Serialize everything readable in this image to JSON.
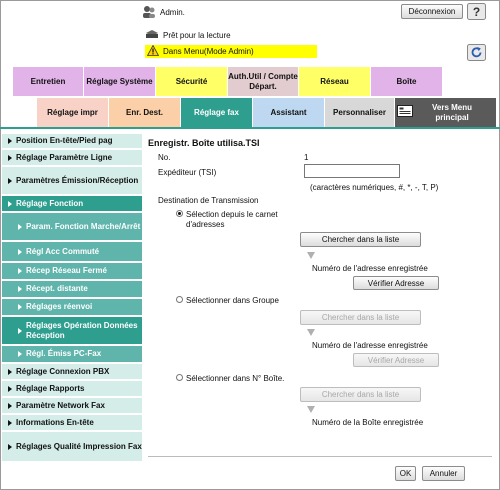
{
  "header": {
    "user": "Admin.",
    "logout_label": "Déconnexion",
    "status_ready": "Prêt pour la lecture",
    "mode_banner": "Dans Menu(Mode Admin)"
  },
  "tabs_top": [
    {
      "label": "Entretien"
    },
    {
      "label": "Réglage Système"
    },
    {
      "label": "Sécurité"
    },
    {
      "label": "Auth.Util / Compte Départ."
    },
    {
      "label": "Réseau"
    },
    {
      "label": "Boîte"
    }
  ],
  "tabs_bottom": [
    {
      "label": "Réglage impr"
    },
    {
      "label": "Enr. Dest."
    },
    {
      "label": "Réglage fax"
    },
    {
      "label": "Assistant"
    },
    {
      "label": "Personnaliser"
    },
    {
      "label": "Vers Menu principal"
    }
  ],
  "sidebar": {
    "items": [
      {
        "label": "Position En-tête/Pied pag"
      },
      {
        "label": "Réglage Paramètre Ligne"
      },
      {
        "label": "Paramètres Émission/Réception"
      },
      {
        "label": "Réglage Fonction"
      },
      {
        "label": "Param. Fonction Marche/Arrêt"
      },
      {
        "label": "Régl Acc Commuté"
      },
      {
        "label": "Récep Réseau Fermé"
      },
      {
        "label": "Récept. distante"
      },
      {
        "label": "Réglages réenvoi"
      },
      {
        "label": "Réglages Opération Données Réception"
      },
      {
        "label": "Régl. Émiss PC-Fax"
      },
      {
        "label": "Réglage Connexion PBX"
      },
      {
        "label": "Réglage Rapports"
      },
      {
        "label": "Paramètre Network Fax"
      },
      {
        "label": "Informations En-tête"
      },
      {
        "label": "Réglages Qualité Impression Fax"
      }
    ]
  },
  "main": {
    "title": "Enregistr. Boîte utilisa.TSI",
    "no_label": "No.",
    "no_value": "1",
    "sender_label": "Expéditeur (TSI)",
    "sender_value": "",
    "sender_hint": "(caractères numériques, #, *, -, T, P)",
    "destination_label": "Destination de Transmission",
    "option1_label": "Sélection depuis le carnet d'adresses",
    "search_label": "Chercher dans la liste",
    "registered_address_label": "Numéro de l'adresse enregistrée",
    "verify_label": "Vérifier Adresse",
    "option2_label": "Sélectionner dans Groupe",
    "option3_label": "Sélectionner dans N° Boîte.",
    "registered_box_label": "Numéro de la Boîte enregistrée",
    "ok_label": "OK",
    "cancel_label": "Annuler"
  }
}
